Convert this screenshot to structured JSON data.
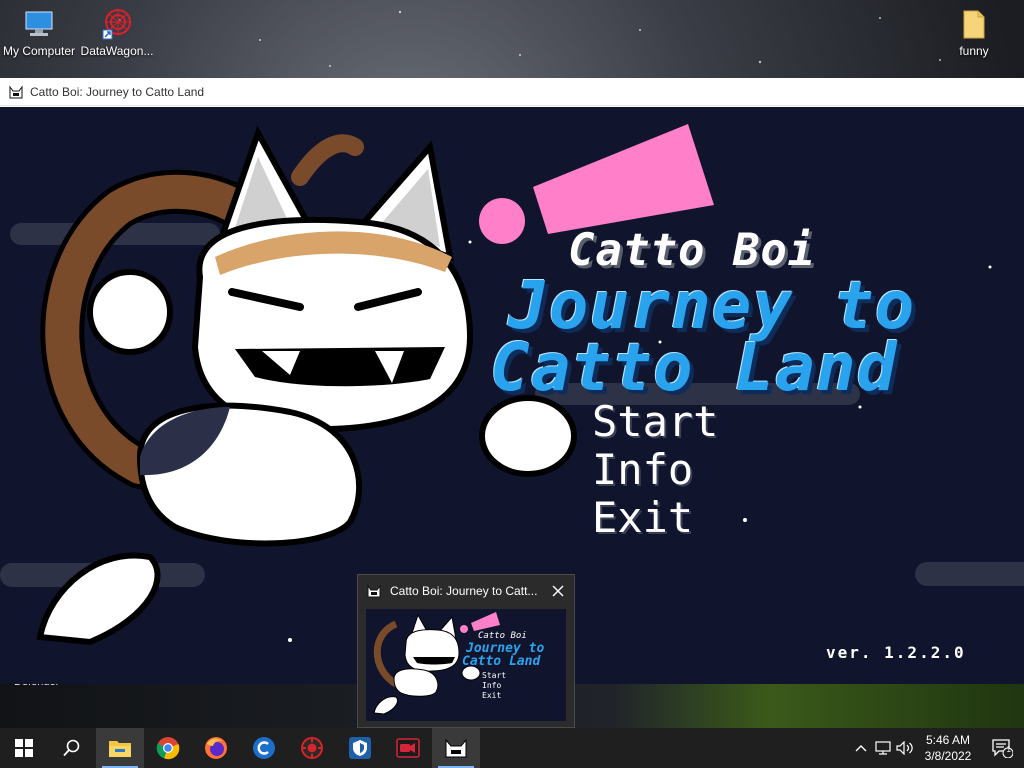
{
  "desktop": {
    "icons": [
      {
        "label": "My Computer",
        "icon": "computer-icon"
      },
      {
        "label": "DataWagon...",
        "icon": "datawagon-icon"
      },
      {
        "label": "funny",
        "icon": "folder-icon"
      }
    ],
    "defender_label": "Defender"
  },
  "game_window": {
    "title": "Catto Boi: Journey to Catto Land",
    "game": {
      "title_small": "Catto Boi",
      "title_big_line1": "Journey to",
      "title_big_line2": "Catto Land",
      "menu": [
        "Start",
        "Info",
        "Exit"
      ],
      "version": "ver. 1.2.2.0"
    }
  },
  "preview": {
    "title": "Catto Boi: Journey to Catt...",
    "thumb": {
      "title_small": "Catto Boi",
      "title_big_line1": "Journey to",
      "title_big_line2": "Catto Land",
      "menu": [
        "Start",
        "Info",
        "Exit"
      ]
    }
  },
  "taskbar": {
    "apps": [
      "start-icon",
      "search-icon",
      "file-explorer-icon",
      "chrome-icon",
      "firefox-icon",
      "ccleaner-icon",
      "antivirus-icon",
      "vpn-shield-icon",
      "video-recorder-icon",
      "catto-game-icon"
    ],
    "clock": {
      "time": "5:46 AM",
      "date": "3/8/2022"
    },
    "notification_count": "1"
  },
  "colors": {
    "game_bg": "#10152d",
    "title_blue": "#2aa3ee",
    "pink": "#ff7fc9",
    "taskbar": "#1f1f1f"
  }
}
